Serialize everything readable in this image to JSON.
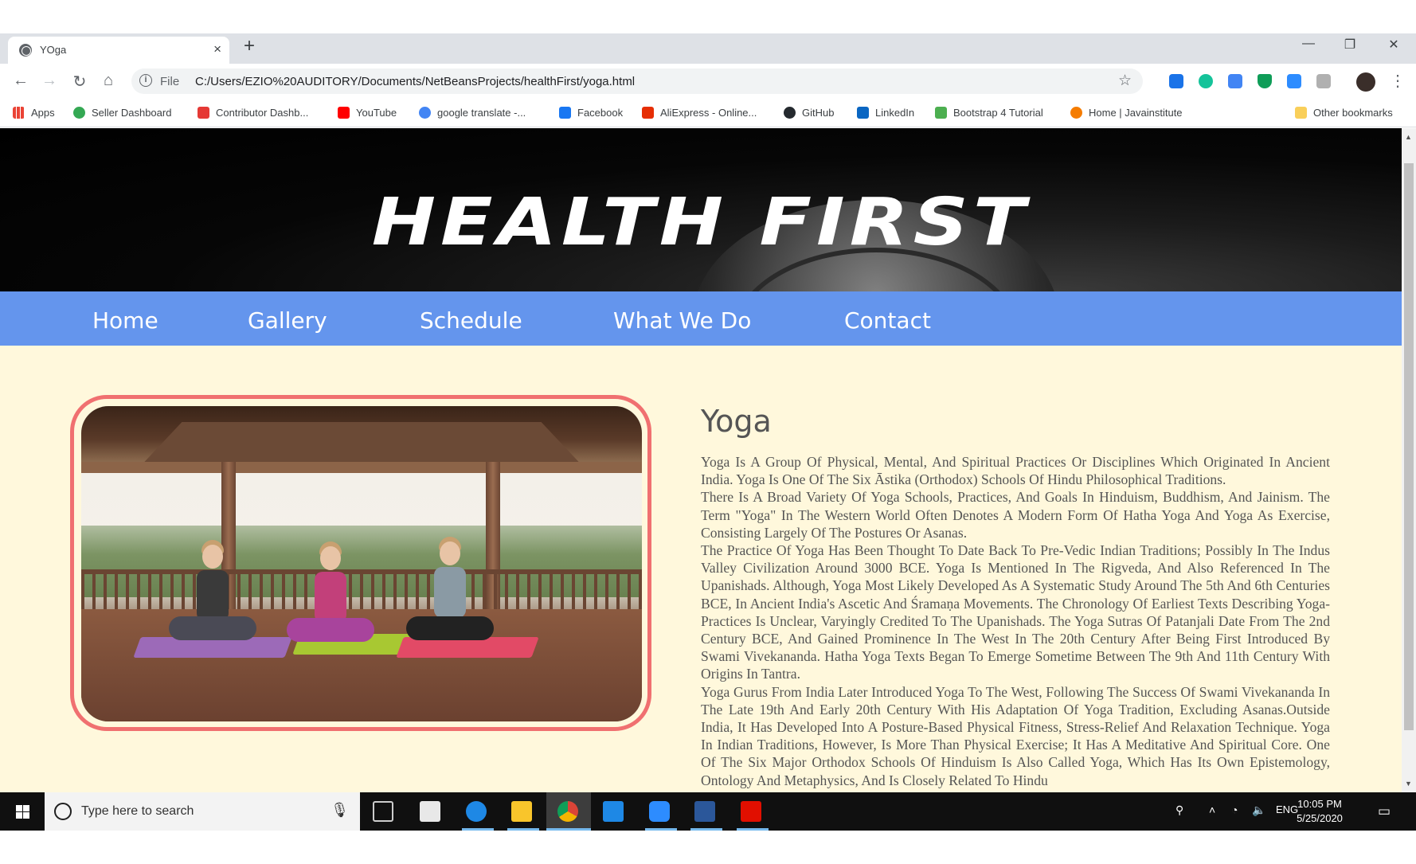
{
  "browser": {
    "tab_title": "YOga",
    "new_tab": "+",
    "close_tab": "×",
    "window_controls": {
      "minimize": "—",
      "restore": "❐",
      "close": "✕"
    },
    "url_scheme": "File",
    "url": "C:/Users/EZIO%20AUDITORY/Documents/NetBeansProjects/healthFirst/yoga.html",
    "bookmarks": [
      {
        "label": "Apps",
        "color": "#ea4335"
      },
      {
        "label": "Seller Dashboard",
        "color": "#34a853"
      },
      {
        "label": "Contributor Dashb...",
        "color": "#e53935"
      },
      {
        "label": "YouTube",
        "color": "#ff0000"
      },
      {
        "label": "google translate -...",
        "color": "#4285f4"
      },
      {
        "label": "Facebook",
        "color": "#1877f2"
      },
      {
        "label": "AliExpress - Online...",
        "color": "#e62e04"
      },
      {
        "label": "GitHub",
        "color": "#24292e"
      },
      {
        "label": "LinkedIn",
        "color": "#0a66c2"
      },
      {
        "label": "Bootstrap 4 Tutorial",
        "color": "#4caf50"
      },
      {
        "label": "Home | Javainstitute",
        "color": "#f57c00"
      }
    ],
    "other_bookmarks": "Other bookmarks"
  },
  "site": {
    "logo": "HEALTH FIRST",
    "nav": [
      "Home",
      "Gallery",
      "Schedule",
      "What We Do",
      "Contact"
    ],
    "accent": "#6495ed",
    "background": "#fff8dc",
    "frame_color": "#f07070"
  },
  "article": {
    "title": "Yoga",
    "paragraphs": [
      "Yoga Is A Group Of Physical, Mental, And Spiritual Practices Or Disciplines Which Originated In Ancient India. Yoga Is One Of The Six Āstika (Orthodox) Schools Of Hindu Philosophical Traditions.",
      "There Is A Broad Variety Of Yoga Schools, Practices, And Goals In Hinduism, Buddhism, And Jainism. The Term \"Yoga\" In The Western World Often Denotes A Modern Form Of Hatha Yoga And Yoga As Exercise, Consisting Largely Of The Postures Or Asanas.",
      "The Practice Of Yoga Has Been Thought To Date Back To Pre-Vedic Indian Traditions; Possibly In The Indus Valley Civilization Around 3000 BCE. Yoga Is Mentioned In The Rigveda, And Also Referenced In The Upanishads. Although, Yoga Most Likely Developed As A Systematic Study Around The 5th And 6th Centuries BCE, In Ancient India's Ascetic And Śramaṇa Movements. The Chronology Of Earliest Texts Describing Yoga-Practices Is Unclear, Varyingly Credited To The Upanishads. The Yoga Sutras Of Patanjali Date From The 2nd Century BCE, And Gained Prominence In The West In The 20th Century After Being First Introduced By Swami Vivekananda. Hatha Yoga Texts Began To Emerge Sometime Between The 9th And 11th Century With Origins In Tantra.",
      "Yoga Gurus From India Later Introduced Yoga To The West, Following The Success Of Swami Vivekananda In The Late 19th And Early 20th Century With His Adaptation Of Yoga Tradition, Excluding Asanas.Outside India, It Has Developed Into A Posture-Based Physical Fitness, Stress-Relief And Relaxation Technique. Yoga In Indian Traditions, However, Is More Than Physical Exercise; It Has A Meditative And Spiritual Core. One Of The Six Major Orthodox Schools Of Hinduism Is Also Called Yoga, Which Has Its Own Epistemology, Ontology And Metaphysics, And Is Closely Related To Hindu"
    ]
  },
  "taskbar": {
    "search_placeholder": "Type here to search",
    "language": "ENG",
    "time": "10:05 PM",
    "date": "5/25/2020"
  }
}
